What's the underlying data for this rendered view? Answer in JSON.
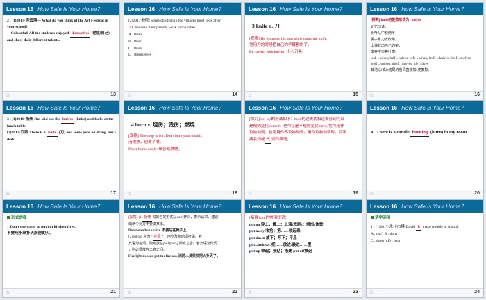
{
  "header": {
    "lesson": "Lesson 16",
    "title": "How Safe Is Your Home？"
  },
  "slides": [
    {
      "num": "13",
      "lines": [
        "2 . (1)2017·连云港—  What do you think of the Art Festival in your school?",
        "—Colourful! All the students enjoyed",
        "themselves",
        "(他们自己) and show their different talents."
      ]
    },
    {
      "num": "14",
      "lines": [
        "(2)2017·衡阳  Some children in the villages must look after",
        "D",
        "because their parents work in the cities.",
        "A . them",
        "B . their",
        "C . theirs",
        "D . themselves"
      ]
    },
    {
      "num": "15",
      "lines": [
        "3  knife n. 刀",
        "[观察] He wounded his arm while using the knife.",
        "他用刀的时候把自己的手臂割伤了。",
        "Be careful with knives! 小心刀具！"
      ]
    },
    {
      "num": "16",
      "lines": [
        "[探究] knife的复数形式为",
        "knives",
        "记忆口诀：",
        "树叶从中裂两半，",
        "妻子拿刀去砍柴。",
        "山狼背出自己的架，",
        "废弃空壳等叶廉。",
        "leaf→leaves, half→halves, wife→wives, knife→knives, shelf→shelves, wolf→wolves, thief→thieves, life→lives",
        "其他以f或fe结尾的名词直接加s变复数。"
      ]
    },
    {
      "num": "17",
      "lines": [
        "3 . (1)2016·扬州 Jim laid out the",
        "knives",
        "(knife) and forks at the lunch table.",
        "(2)2017·江西 There is a",
        "knife",
        "(刀) and some pens on Wang Jun's desk."
      ]
    },
    {
      "num": "18",
      "lines": [
        "4  burn v. 烧伤；烫伤；燃烧",
        "[观察] The soup is hot. Don't burn your mouth.",
        "汤很热，别烫了嘴。",
        "Paper burns easily. 纸容易燃烧。"
      ]
    },
    {
      "num": "19",
      "lines": [
        "[探究] lie, lay的用法如下：burn的过去式和过去分词可以",
        "是规则变化burned，也可以是不规则变化burnt; 它可用作",
        "及物动词，也可用作不及物动词。用作及物动词时，后面",
        "接名词或",
        "代",
        "词作宾语。"
      ]
    },
    {
      "num": "20",
      "lines": [
        "4 . There is a candle",
        "burning",
        "(burn) in my room."
      ]
    },
    {
      "num": "21",
      "lines": [
        "形式透视",
        "1  Don't use water to put out kitchen fires.",
        "不要用水来扑灭厨房的火。"
      ]
    },
    {
      "num": "22",
      "lines": [
        "[探究] (1)",
        "祈使",
        "句的否定形式以don't开头，表示请求、建议",
        "或命令对方不要做某事。",
        "Don't stand on chairs. 不要站在椅子上。",
        "(2)put out 意为 “",
        "扑灭",
        "”，用作及物动词符语。若",
        "宾语为名词，则可放在put与out之间或之后；若宾语为代词",
        "，则必须放在二者之间。",
        "Firefighters soon put the fire out. 消防人员很快把火扑灭了。"
      ]
    },
    {
      "num": "23",
      "lines": [
        "[拓展] put的常用短语：",
        "put on 穿上，戴上；上演(戏剧)；增加(体重)",
        "put away 收拾；把……收起来",
        "put down 放下；写下；平息",
        "put...in/into...把……放进/装进……里",
        "put up 举起；张贴；搭建    put off推迟"
      ]
    },
    {
      "num": "24",
      "lines": [
        "活学活用",
        "1 . (1)2017·永州市模  David",
        "B",
        "make trouble at school.",
        "A . can't    B . don't",
        "C . doesn't  D . isn't"
      ]
    }
  ],
  "colors": {
    "header_bg": "#0a6a9a",
    "answer": "#d0021b",
    "accent_green": "#1b8a3c"
  },
  "icons": {
    "footer": "star-icon"
  }
}
